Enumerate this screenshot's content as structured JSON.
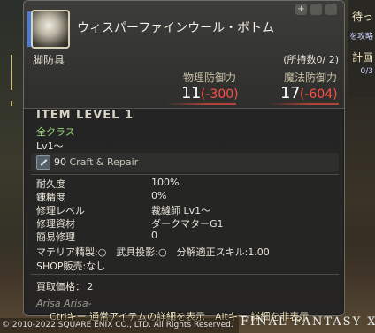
{
  "background": {
    "right_texts": [
      "待っ",
      "を攻略",
      "計画",
      "0/3"
    ]
  },
  "tooltip": {
    "item_name": "ウィスパーファインウール・ボトム",
    "hq_symbol": "",
    "top_icons": [
      "+",
      "",
      ""
    ],
    "slot": "脚防具",
    "owned_label": "(所持数0/",
    "owned_hq": "2)",
    "stats": [
      {
        "label": "物理防御力",
        "base": "11",
        "diff": "(-300)"
      },
      {
        "label": "魔法防御力",
        "base": "17",
        "diff": "(-604)"
      }
    ],
    "item_level": "ITEM LEVEL 1",
    "classes": "全クラス",
    "level": "Lv1～",
    "craft": {
      "number": "90",
      "label": "Craft & Repair"
    },
    "details": [
      {
        "label": "耐久度",
        "value": "100%"
      },
      {
        "label": "錬精度",
        "value": "0%"
      },
      {
        "label": "修理レベル",
        "value": "裁縫師 Lv1～"
      },
      {
        "label": "修理資材",
        "value": "ダークマターG1"
      },
      {
        "label": "簡易修理",
        "value": "0"
      }
    ],
    "materia": "マテリア精製:○　武具投影:○　分解適正スキル:1.00",
    "shop": "SHOP販売:なし",
    "sell_price": "買取価格：２",
    "crafter": "Arisa Arisa-"
  },
  "footer": {
    "hint": "Ctrlキー 通常アイテムの詳細を表示　Altキー 詳細を非表示",
    "copyright": "© 2010-2022 SQUARE ENIX CO., LTD. All Rights Reserved.",
    "logo": "FINAL FANTASY XIV"
  }
}
